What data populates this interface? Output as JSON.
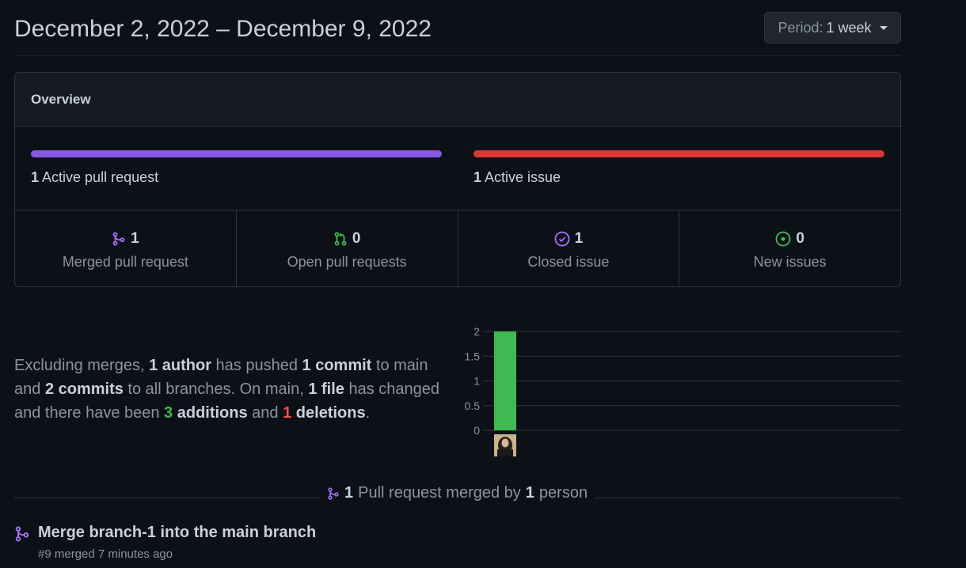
{
  "header": {
    "title": "December 2, 2022 – December 9, 2022",
    "period_label": "Period:",
    "period_value": "1 week"
  },
  "overview": {
    "heading": "Overview",
    "pr_count": "1",
    "pr_label": "Active pull request",
    "issue_count": "1",
    "issue_label": "Active issue",
    "pr_bar_fraction": 1.0,
    "issue_bar_fraction": 1.0,
    "colors": {
      "pr": "#8957e5",
      "issue": "#da3633"
    },
    "stats": [
      {
        "icon": "git-merge-icon",
        "count": "1",
        "label": "Merged pull request",
        "color": "#a371f7"
      },
      {
        "icon": "git-pull-request-icon",
        "count": "0",
        "label": "Open pull requests",
        "color": "#3fb950"
      },
      {
        "icon": "issue-closed-icon",
        "count": "1",
        "label": "Closed issue",
        "color": "#a371f7"
      },
      {
        "icon": "issue-opened-icon",
        "count": "0",
        "label": "New issues",
        "color": "#3fb950"
      }
    ]
  },
  "summary": {
    "t1": "Excluding merges, ",
    "authors": "1 author",
    "t2": " has pushed ",
    "commits_main": "1 commit",
    "t3": " to main and ",
    "commits_all": "2 commits",
    "t4": " to all branches. On main, ",
    "files": "1 file",
    "t5": " has changed and there have been ",
    "additions_num": "3",
    "additions_word": " additions",
    "t6": " and ",
    "deletions_num": "1",
    "deletions_word": " deletions",
    "t7": "."
  },
  "chart_data": {
    "type": "bar",
    "categories": [
      "author"
    ],
    "values": [
      2
    ],
    "y_ticks": [
      "0",
      "0.5",
      "1",
      "1.5",
      "2"
    ],
    "ylim": [
      0,
      2
    ],
    "grid": true,
    "bar_color": "#3fb950"
  },
  "pr_section": {
    "count": "1",
    "t1": "Pull request merged by",
    "people": "1",
    "t2": "person"
  },
  "pr_item": {
    "title": "Merge branch-1 into the main branch",
    "meta": "#9 merged 7 minutes ago"
  }
}
